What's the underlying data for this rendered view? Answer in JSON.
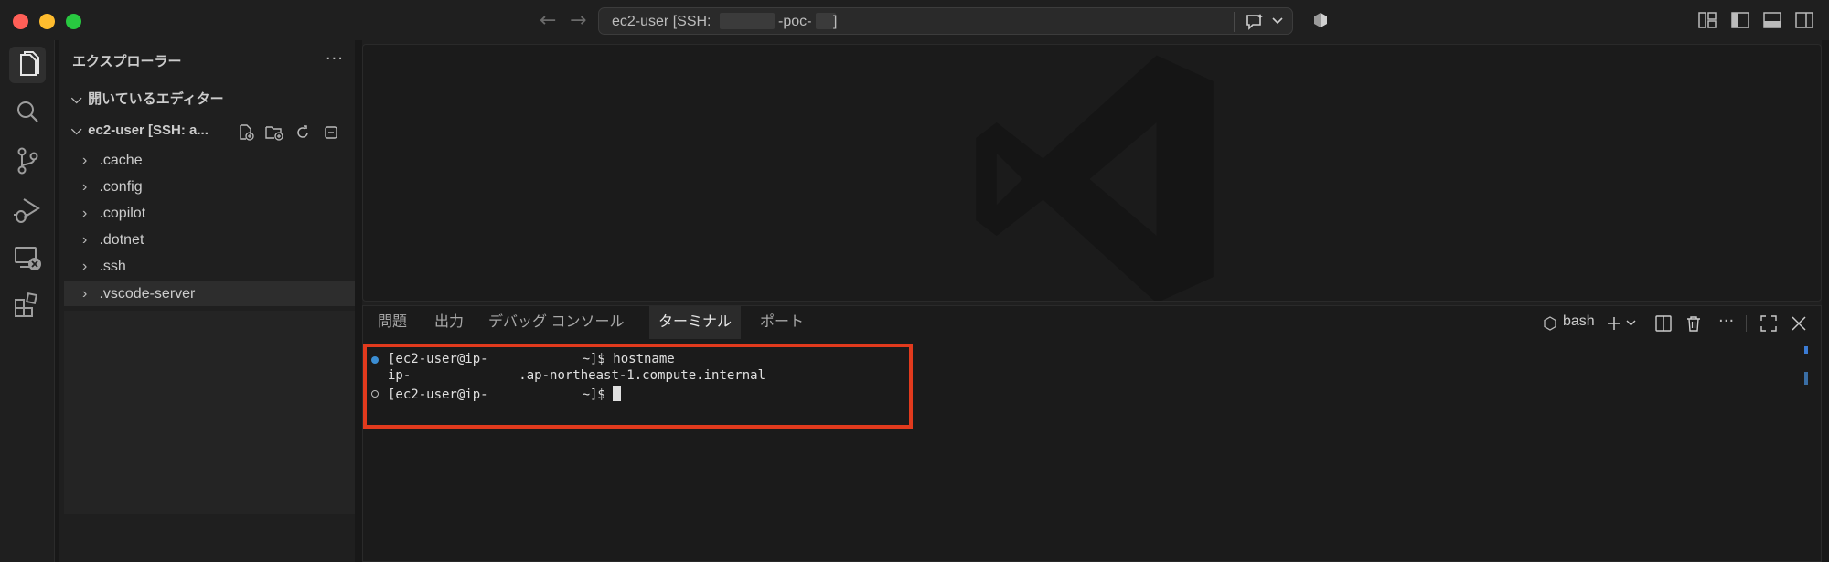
{
  "titlebar": {
    "command_center": "ec2-user [SSH:          -poc-     ]",
    "cmd_prefix": "ec2-user [SSH:",
    "cmd_mid": "-poc-",
    "cmd_suffix": "]"
  },
  "sidebar": {
    "title": "エクスプローラー",
    "more": "···",
    "open_editors": "開いているエディター",
    "workspace": "ec2-user [SSH: a...",
    "items": [
      {
        "label": ".cache"
      },
      {
        "label": ".config"
      },
      {
        "label": ".copilot"
      },
      {
        "label": ".dotnet"
      },
      {
        "label": ".ssh"
      },
      {
        "label": ".vscode-server"
      }
    ]
  },
  "panel": {
    "tabs": [
      "問題",
      "出力",
      "デバッグ コンソール",
      "ターミナル",
      "ポート"
    ],
    "active_tab": "ターミナル",
    "shell": "bash",
    "more": "···"
  },
  "terminal": {
    "line1_prefix": "[ec2-user@ip-",
    "line1_suffix": "~]$ hostname",
    "line2_prefix": "ip-",
    "line2_suffix": ".ap-northeast-1.compute.internal",
    "line3_prefix": "[ec2-user@ip-",
    "line3_suffix": "~]$"
  },
  "colors": {
    "highlight_box": "#e23a1d",
    "accent": "#3b8ed4"
  }
}
